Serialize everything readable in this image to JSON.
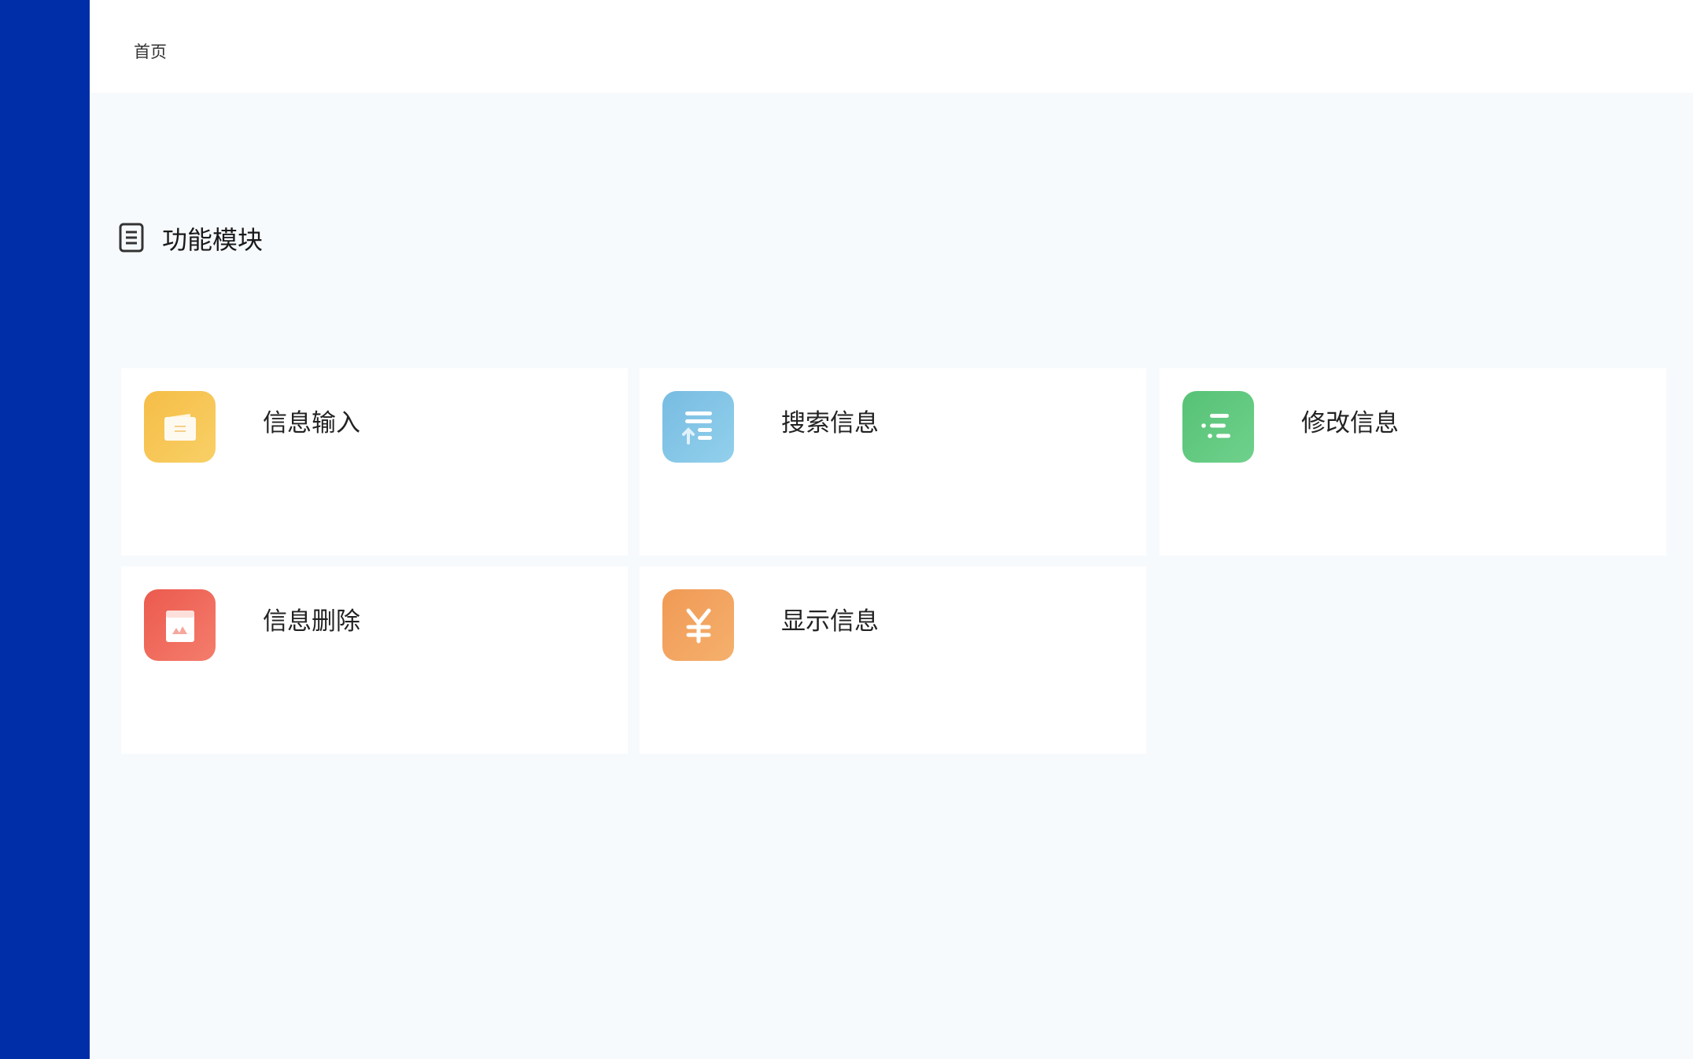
{
  "header": {
    "breadcrumb": "首页"
  },
  "section": {
    "title": "功能模块",
    "icon": "document-list-icon"
  },
  "modules": [
    {
      "label": "信息输入",
      "icon": "wallet-icon",
      "color": "#f6c34f"
    },
    {
      "label": "搜索信息",
      "icon": "sort-list-icon",
      "color": "#7fc3e4"
    },
    {
      "label": "修改信息",
      "icon": "list-icon",
      "color": "#5fc77e"
    },
    {
      "label": "信息删除",
      "icon": "image-card-icon",
      "color": "#ee6459"
    },
    {
      "label": "显示信息",
      "icon": "yen-icon",
      "color": "#f2a05c"
    }
  ],
  "colors": {
    "sidebar": "#002da8",
    "background": "#f7fafd"
  }
}
